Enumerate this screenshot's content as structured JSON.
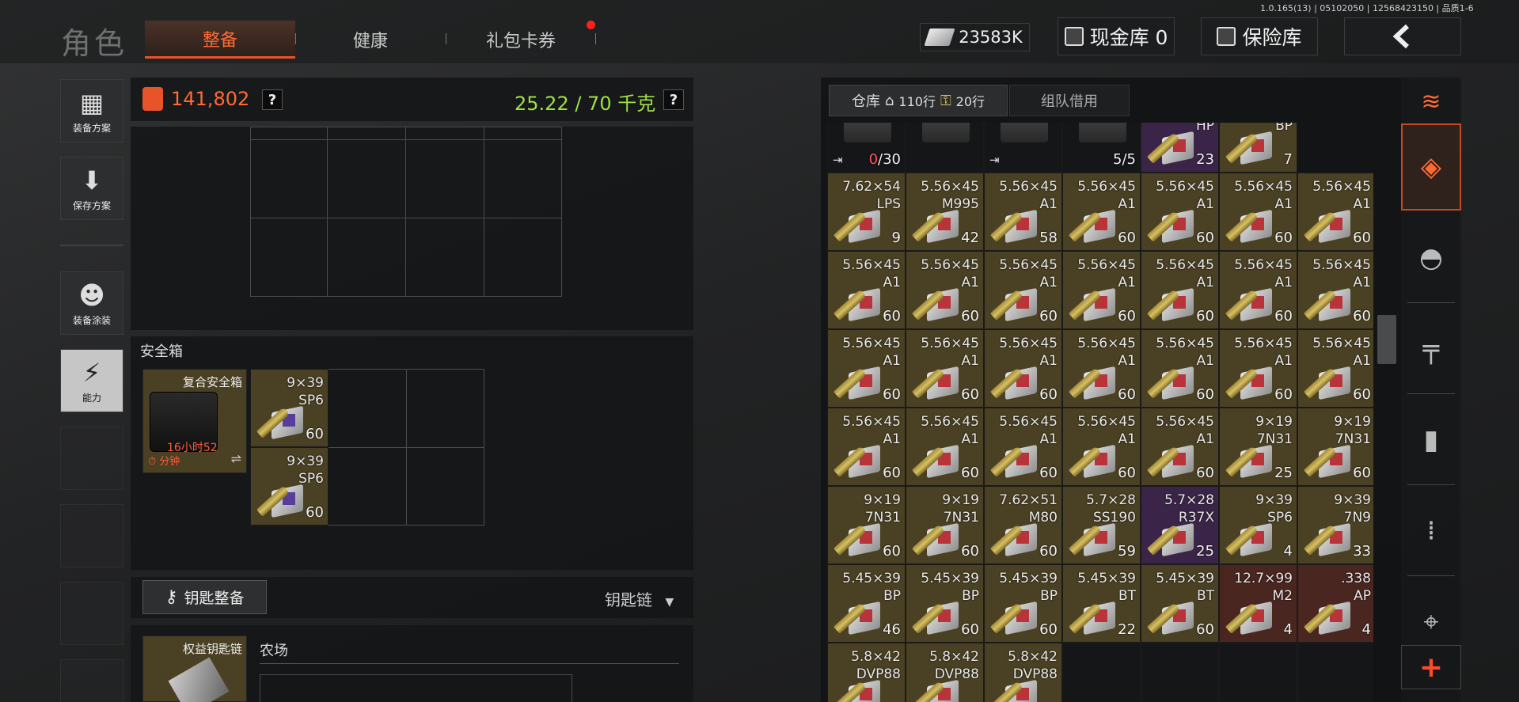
{
  "header": {
    "role_title": "角色",
    "tabs": [
      "整备",
      "健康",
      "礼包卡券"
    ],
    "version": "1.0.165(13) | 05102050 | 12568423150 | 品质1-6",
    "money": "23583K",
    "cash_vault": "现金库 0",
    "insurance": "保险库",
    "back_icon": "chevron-left-icon"
  },
  "sidebar": {
    "items": [
      {
        "label": "装备方案",
        "icon": "vest-icon"
      },
      {
        "label": "保存方案",
        "icon": "download-icon"
      },
      {
        "label": "装备涂装",
        "icon": "soldier-icon"
      },
      {
        "label": "能力",
        "icon": "lightning-icon"
      }
    ]
  },
  "equip": {
    "value": "141,802",
    "weight": "25.22 / 70 千克",
    "q": "?"
  },
  "safebox": {
    "title": "安全箱",
    "name": "复合安全箱",
    "timer": "16小时52",
    "timer_unit": "分钟",
    "items": [
      {
        "cal": "9×39",
        "type": "SP6",
        "count": "60"
      },
      {
        "cal": "9×39",
        "type": "SP6",
        "count": "60"
      }
    ]
  },
  "keys": {
    "button": "钥匙整备",
    "chain": "钥匙链",
    "slot_name": "权益钥匙链",
    "zone": "农场"
  },
  "storage": {
    "tabs": {
      "warehouse": "仓库",
      "rows": "110行",
      "rows2": "20行",
      "team": "组队借用"
    },
    "top_row": [
      {
        "cal": "",
        "type": "",
        "count_red": "0",
        "count": "/30",
        "color": "dark",
        "img": "magazine"
      },
      {
        "cal": "",
        "type": "",
        "count": "",
        "color": "dark",
        "img": "grenade"
      },
      {
        "cal": "",
        "type": "",
        "count": "",
        "color": "dark",
        "img": "canister"
      },
      {
        "cal": "",
        "type": "",
        "count": "5/5",
        "color": "dark",
        "img": "case"
      },
      {
        "cal": "",
        "type": "HP",
        "count": "23",
        "color": "purple",
        "img": "ammo"
      },
      {
        "cal": "",
        "type": "BP",
        "count": "7",
        "color": "gold",
        "img": "ammo"
      }
    ],
    "rows": [
      [
        {
          "cal": "7.62×54",
          "type": "LPS",
          "count": "9"
        },
        {
          "cal": "5.56×45",
          "type": "M995",
          "count": "42"
        },
        {
          "cal": "5.56×45",
          "type": "A1",
          "count": "58"
        },
        {
          "cal": "5.56×45",
          "type": "A1",
          "count": "60"
        },
        {
          "cal": "5.56×45",
          "type": "A1",
          "count": "60"
        },
        {
          "cal": "5.56×45",
          "type": "A1",
          "count": "60"
        },
        {
          "cal": "5.56×45",
          "type": "A1",
          "count": "60"
        }
      ],
      [
        {
          "cal": "5.56×45",
          "type": "A1",
          "count": "60"
        },
        {
          "cal": "5.56×45",
          "type": "A1",
          "count": "60"
        },
        {
          "cal": "5.56×45",
          "type": "A1",
          "count": "60"
        },
        {
          "cal": "5.56×45",
          "type": "A1",
          "count": "60"
        },
        {
          "cal": "5.56×45",
          "type": "A1",
          "count": "60"
        },
        {
          "cal": "5.56×45",
          "type": "A1",
          "count": "60"
        },
        {
          "cal": "5.56×45",
          "type": "A1",
          "count": "60"
        }
      ],
      [
        {
          "cal": "5.56×45",
          "type": "A1",
          "count": "60"
        },
        {
          "cal": "5.56×45",
          "type": "A1",
          "count": "60"
        },
        {
          "cal": "5.56×45",
          "type": "A1",
          "count": "60"
        },
        {
          "cal": "5.56×45",
          "type": "A1",
          "count": "60"
        },
        {
          "cal": "5.56×45",
          "type": "A1",
          "count": "60"
        },
        {
          "cal": "5.56×45",
          "type": "A1",
          "count": "60"
        },
        {
          "cal": "5.56×45",
          "type": "A1",
          "count": "60"
        }
      ],
      [
        {
          "cal": "5.56×45",
          "type": "A1",
          "count": "60"
        },
        {
          "cal": "5.56×45",
          "type": "A1",
          "count": "60"
        },
        {
          "cal": "5.56×45",
          "type": "A1",
          "count": "60"
        },
        {
          "cal": "5.56×45",
          "type": "A1",
          "count": "60"
        },
        {
          "cal": "5.56×45",
          "type": "A1",
          "count": "60"
        },
        {
          "cal": "9×19",
          "type": "7N31",
          "count": "25"
        },
        {
          "cal": "9×19",
          "type": "7N31",
          "count": "60"
        }
      ],
      [
        {
          "cal": "9×19",
          "type": "7N31",
          "count": "60"
        },
        {
          "cal": "9×19",
          "type": "7N31",
          "count": "60"
        },
        {
          "cal": "7.62×51",
          "type": "M80",
          "count": "60"
        },
        {
          "cal": "5.7×28",
          "type": "SS190",
          "count": "59"
        },
        {
          "cal": "5.7×28",
          "type": "R37X",
          "count": "25",
          "color": "purple"
        },
        {
          "cal": "9×39",
          "type": "SP6",
          "count": "4"
        },
        {
          "cal": "9×39",
          "type": "7N9",
          "count": "33"
        }
      ],
      [
        {
          "cal": "5.45×39",
          "type": "BP",
          "count": "46"
        },
        {
          "cal": "5.45×39",
          "type": "BP",
          "count": "60"
        },
        {
          "cal": "5.45×39",
          "type": "BP",
          "count": "60"
        },
        {
          "cal": "5.45×39",
          "type": "BT",
          "count": "22"
        },
        {
          "cal": "5.45×39",
          "type": "BT",
          "count": "60"
        },
        {
          "cal": "12.7×99",
          "type": "M2",
          "count": "4",
          "color": "red"
        },
        {
          "cal": ".338",
          "type": "AP",
          "count": "4",
          "color": "red"
        }
      ],
      [
        {
          "cal": "5.8×42",
          "type": "DVP88",
          "count": ""
        },
        {
          "cal": "5.8×42",
          "type": "DVP88",
          "count": ""
        },
        {
          "cal": "5.8×42",
          "type": "DVP88",
          "count": ""
        }
      ]
    ]
  },
  "rightbar": {
    "icons": [
      "stack-refresh-icon",
      "layers-icon",
      "helmet-icon",
      "rifle-icon",
      "magazine-icon",
      "bullet-icon",
      "scope-icon",
      "plus-icon"
    ]
  }
}
